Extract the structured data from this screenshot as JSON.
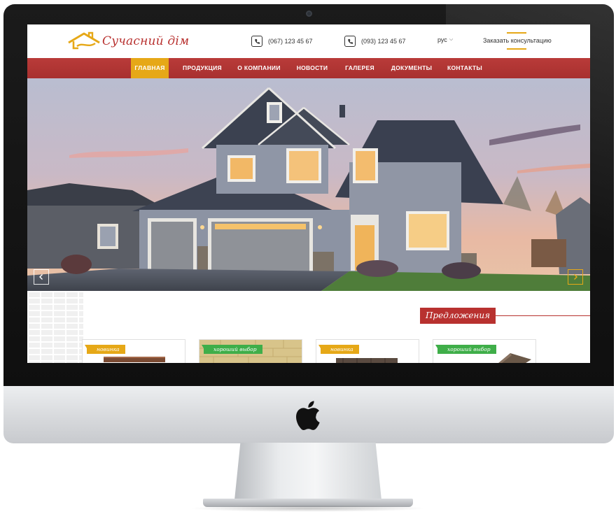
{
  "header": {
    "logo_text": "Сучасний дім",
    "phone_1": "(067) 123 45 67",
    "phone_2": "(093) 123 45 67",
    "language": "рус",
    "consult_link": "Заказать консультацию"
  },
  "nav": {
    "items": [
      {
        "label": "ГЛАВНАЯ",
        "active": true
      },
      {
        "label": "ПРОДУКЦИЯ",
        "active": false
      },
      {
        "label": "О КОМПАНИИ",
        "active": false
      },
      {
        "label": "НОВОСТИ",
        "active": false
      },
      {
        "label": "ГАЛЕРЕЯ",
        "active": false
      },
      {
        "label": "ДОКУМЕНТЫ",
        "active": false
      },
      {
        "label": "КОНТАКТЫ",
        "active": false
      }
    ]
  },
  "hero": {
    "prev_icon": "chevron-left-icon",
    "next_icon": "chevron-right-icon"
  },
  "offers": {
    "title": "Предложения",
    "cards": [
      {
        "badge": "новинка",
        "badge_type": "new"
      },
      {
        "badge": "хороший выбор",
        "badge_type": "good"
      },
      {
        "badge": "новинка",
        "badge_type": "new"
      },
      {
        "badge": "хороший выбор",
        "badge_type": "good"
      }
    ]
  },
  "colors": {
    "brand_red": "#b8312f",
    "accent_yellow": "#e6a817",
    "badge_green": "#3fae49"
  }
}
